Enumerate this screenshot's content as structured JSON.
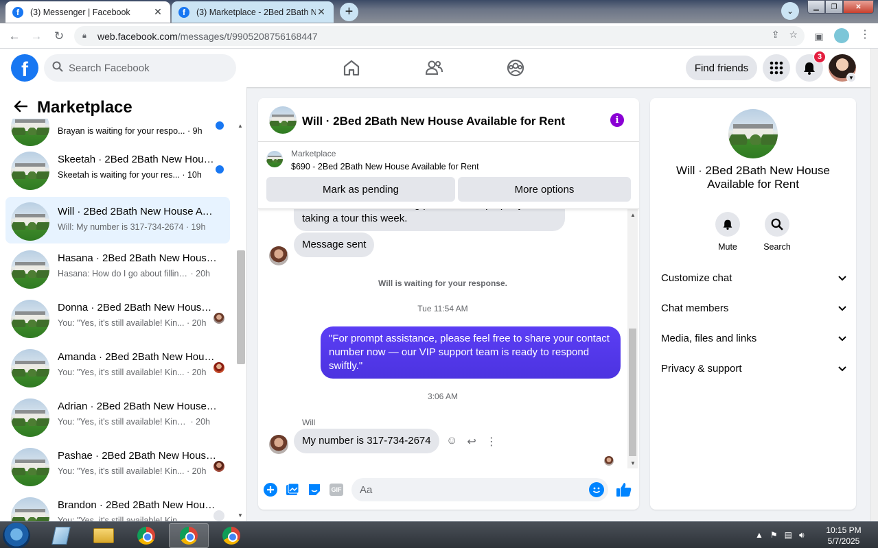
{
  "browser": {
    "tabs": [
      {
        "title": "(3) Messenger | Facebook",
        "active": true
      },
      {
        "title": "(3) Marketplace - 2Bed 2Bath Ne",
        "active": false
      }
    ],
    "url_host": "web.facebook.com",
    "url_path": "/messages/t/9905208756168447"
  },
  "fb_header": {
    "search_placeholder": "Search Facebook",
    "find_friends": "Find friends",
    "notification_count": "3"
  },
  "sidebar": {
    "title": "Marketplace",
    "conversations": [
      {
        "name": "",
        "preview": "Brayan is waiting for your respo...",
        "time": "· 9h",
        "unread": true
      },
      {
        "name": "Skeetah · 2Bed 2Bath New House Available for Rent",
        "preview": "Skeetah is waiting for your res...",
        "time": "· 10h",
        "unread": true
      },
      {
        "name": "Will · 2Bed 2Bath New House Available for Rent",
        "preview": "Will: My number is 317-734-2674",
        "time": "· 19h",
        "active": true
      },
      {
        "name": "Hasana · 2Bed 2Bath New House Available for Rent",
        "preview": "Hasana: How do I go about filling...",
        "time": "· 20h"
      },
      {
        "name": "Donna · 2Bed 2Bath New House Available for Rent",
        "preview": "You: \"Yes, it's still available! Kin...",
        "time": "· 20h"
      },
      {
        "name": "Amanda · 2Bed 2Bath New House Available for Rent",
        "preview": "You: \"Yes, it's still available! Kin...",
        "time": "· 20h"
      },
      {
        "name": "Adrian · 2Bed 2Bath New House Available for Rent",
        "preview": "You: \"Yes, it's still available! Kindly ...",
        "time": "· 20h"
      },
      {
        "name": "Pashae · 2Bed 2Bath New House Available for Rent",
        "preview": "You: \"Yes, it's still available! Kin...",
        "time": "· 20h"
      },
      {
        "name": "Brandon · 2Bed 2Bath New House Available for Rent",
        "preview": "You: \"Yes, it's still available! Kin...",
        "time": ""
      }
    ]
  },
  "chat": {
    "title": "Will · 2Bed 2Bath New House Available for Rent",
    "listing_source": "Marketplace",
    "listing_desc": "$690 - 2Bed 2Bath New House Available for Rent",
    "mark_pending": "Mark as pending",
    "more_options": "More options",
    "partial_message": "Hi I'm interested in seeing photos of the property and taking a tour this week.",
    "message_sent": "Message sent",
    "waiting_notice": "Will is waiting for your response.",
    "time1": "Tue 11:54 AM",
    "outgoing": "\"For prompt assistance, please feel free to share your contact number now — our VIP support team is ready to respond swiftly.\"",
    "time2": "3:06 AM",
    "sender": "Will",
    "incoming": "My number is 317-734-2674",
    "composer_placeholder": "Aa",
    "gif_label": "GIF"
  },
  "info_panel": {
    "title": "Will · 2Bed 2Bath New House Available for Rent",
    "mute": "Mute",
    "search": "Search",
    "rows": [
      "Customize chat",
      "Chat members",
      "Media, files and links",
      "Privacy & support"
    ]
  },
  "taskbar": {
    "time": "10:15 PM",
    "date": "5/7/2025"
  }
}
